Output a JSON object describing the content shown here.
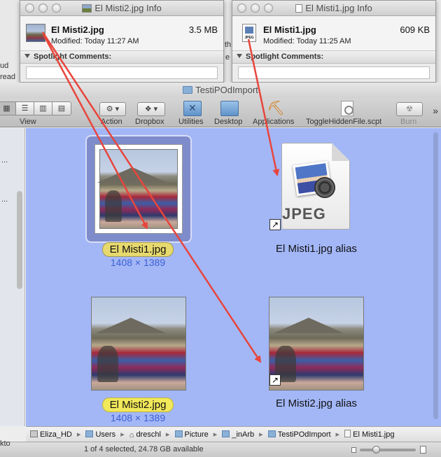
{
  "info_windows": [
    {
      "title": "El Misti2.jpg Info",
      "file_name": "El Misti2.jpg",
      "file_size": "3.5 MB",
      "modified": "Modified: Today 11:27 AM",
      "section": "Spotlight Comments:"
    },
    {
      "title": "El Misti1.jpg Info",
      "file_name": "El Misti1.jpg",
      "file_size": "609 KB",
      "modified": "Modified: Today 11:25 AM",
      "section": "Spotlight Comments:",
      "icon_text": "JPEG"
    }
  ],
  "finder": {
    "title": "TestiPOdImport",
    "toolbar": {
      "view": "View",
      "action": "Action",
      "dropbox": "Dropbox",
      "utilities": "Utilities",
      "desktop": "Desktop",
      "applications": "Applications",
      "script": "ToggleHiddenFile.scpt",
      "burn": "Burn",
      "overflow": "»"
    },
    "items": [
      {
        "name": "El Misti1.jpg",
        "dims": "1408 × 1389"
      },
      {
        "name": "El Misti1.jpg alias",
        "icon_type": "JPEG"
      },
      {
        "name": "El Misti2.jpg",
        "dims": "1408 × 1389"
      },
      {
        "name": "El Misti2.jpg alias"
      }
    ],
    "path": [
      "Eliza_HD",
      "Users",
      "dreschl",
      "Picture",
      "_inArb",
      "TestiPOdImport",
      "El Misti1.jpg"
    ],
    "status": "1 of 4 selected, 24.78 GB available"
  },
  "background_fragments": [
    "ud",
    "read",
    "th",
    "e",
    "...",
    "...",
    "kto"
  ],
  "colors": {
    "annotation_arrow": "#e8453c",
    "content_bg": "#a3b7f7",
    "selection_frame": "#7f8ccb",
    "dims_text": "#3d5fd3"
  }
}
